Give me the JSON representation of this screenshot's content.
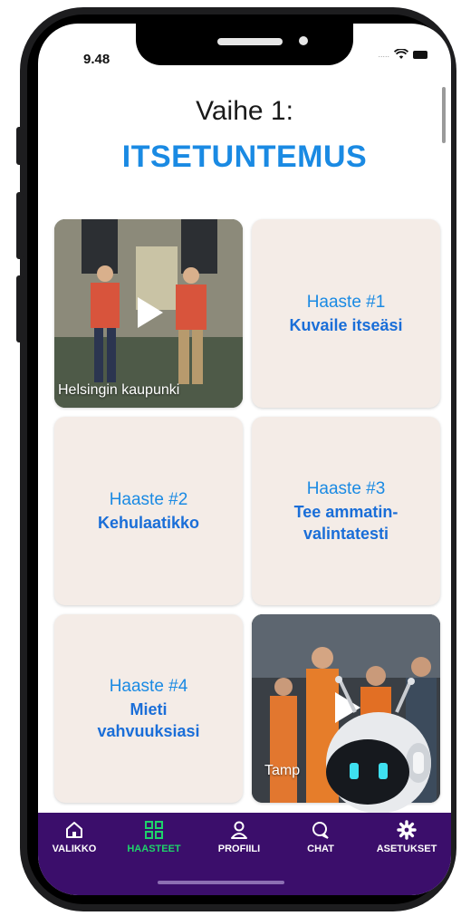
{
  "status_bar": {
    "time": "9.48",
    "signal": "....."
  },
  "header": {
    "step_title": "Vaihe 1:",
    "step_subtitle": "ITSETUNTEMUS"
  },
  "tiles": [
    {
      "type": "video",
      "caption": "Helsingin kaupunki"
    },
    {
      "type": "challenge",
      "number": "Haaste #1",
      "name": "Kuvaile itseäsi"
    },
    {
      "type": "challenge",
      "number": "Haaste #2",
      "name": "Kehulaatikko"
    },
    {
      "type": "challenge",
      "number": "Haaste #3",
      "name": "Tee ammatin-valintatesti"
    },
    {
      "type": "challenge",
      "number": "Haaste #4",
      "name": "Mieti vahvuuksiasi"
    },
    {
      "type": "video",
      "caption": "Tamp"
    }
  ],
  "tabbar": {
    "active": "haasteet",
    "items": [
      {
        "label": "VALIKKO",
        "icon": "home-icon"
      },
      {
        "label": "HAASTEET",
        "icon": "grid-icon"
      },
      {
        "label": "PROFIILI",
        "icon": "person-icon"
      },
      {
        "label": "CHAT",
        "icon": "chat-bubble-icon"
      },
      {
        "label": "ASETUKSET",
        "icon": "gear-icon"
      }
    ]
  },
  "colors": {
    "accent_blue": "#1a8ae3",
    "tile_bg": "#f4ece7",
    "tabbar_bg": "#3b0e6b",
    "active_tab": "#1ed36a"
  }
}
